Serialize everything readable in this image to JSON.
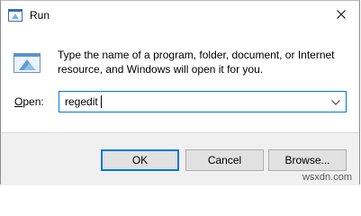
{
  "window": {
    "title": "Run",
    "app_icon": "run-icon",
    "close_icon": "close-icon"
  },
  "dialog": {
    "description": "Type the name of a program, folder, document, or Internet resource, and Windows will open it for you.",
    "open_label_accel": "O",
    "open_label_rest": "pen:",
    "input_value": "regedit"
  },
  "buttons": {
    "ok": "OK",
    "cancel": "Cancel",
    "browse": "Browse..."
  },
  "watermark": "wsxdn.com"
}
